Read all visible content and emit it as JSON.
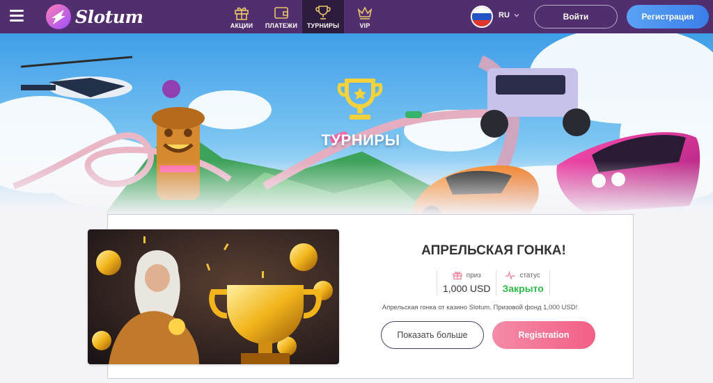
{
  "header": {
    "logo_text": "Slotum",
    "nav": [
      {
        "label": "АКЦИИ",
        "icon": "gift-icon",
        "active": false
      },
      {
        "label": "ПЛАТЕЖИ",
        "icon": "wallet-icon",
        "active": false
      },
      {
        "label": "ТУРНИРЫ",
        "icon": "trophy-icon",
        "active": true
      },
      {
        "label": "VIP",
        "icon": "crown-icon",
        "active": false
      }
    ],
    "language": "RU",
    "login_label": "Войти",
    "register_label": "Регистрация"
  },
  "hero": {
    "title": "ТУРНИРЫ"
  },
  "tournament": {
    "title": "АПРЕЛЬСКАЯ ГОНКА!",
    "prize_label": "приз",
    "prize_value": "1,000 USD",
    "status_label": "статус",
    "status_value": "Закрыто",
    "description": "Апрельская гонка от казино Slotum. Призовой фонд 1,000 USD!",
    "more_label": "Показать больше",
    "register_label": "Registration"
  },
  "colors": {
    "header_bg": "#512e6d",
    "nav_active_bg": "#2e1c3f",
    "accent_gold": "#f5d23c",
    "register_blue": "#3b7ee9",
    "register_pink": "#f35f86",
    "status_closed": "#2fb94a"
  }
}
